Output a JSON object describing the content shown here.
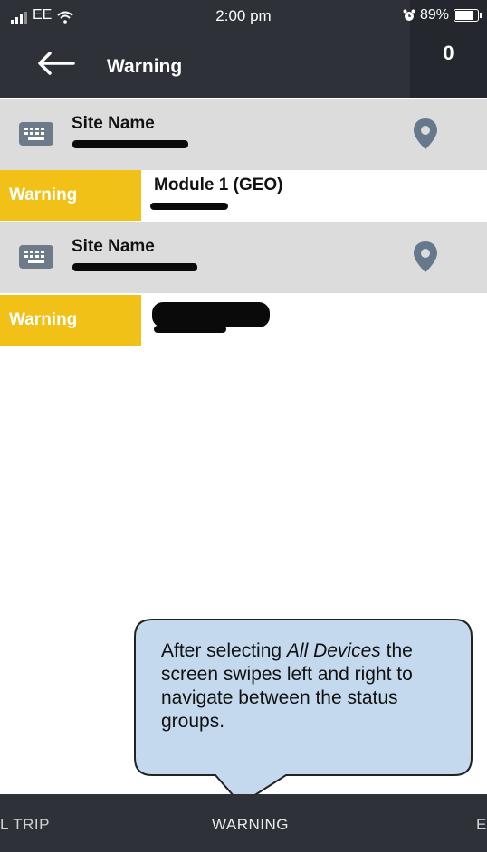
{
  "status_bar": {
    "carrier": "EE",
    "time": "2:00 pm",
    "battery": "89%"
  },
  "header": {
    "title": "Warning",
    "count": "0"
  },
  "list": [
    {
      "site_label": "Site Name",
      "status": "Warning",
      "module": "Module 1 (GEO)"
    },
    {
      "site_label": "Site Name",
      "status": "Warning",
      "module": ""
    }
  ],
  "callout": {
    "line1_prefix": "After selecting ",
    "line1_emphasis": "All Devices",
    "rest": "the screen swipes left and right to navigate between the status groups."
  },
  "tabs": {
    "left_partial": "L TRIP",
    "current": "WARNING",
    "right_partial": "E"
  },
  "colors": {
    "header_bg": "#2e3138",
    "warning": "#f2c118",
    "site_row_bg": "#dcdcdc",
    "callout_fill": "#c4d9ee",
    "pin": "#66788b"
  },
  "icons": [
    "signal-icon",
    "wifi-icon",
    "alarm-icon",
    "battery-icon",
    "back-arrow-icon",
    "keyboard-icon",
    "map-pin-icon"
  ]
}
